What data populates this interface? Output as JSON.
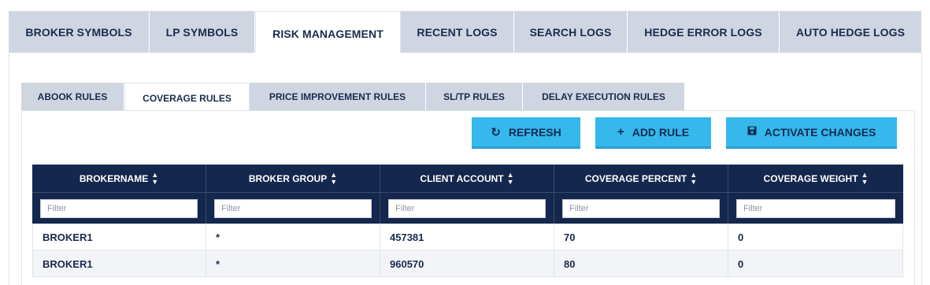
{
  "top_tabs": [
    {
      "label": "BROKER SYMBOLS"
    },
    {
      "label": "LP SYMBOLS"
    },
    {
      "label": "RISK MANAGEMENT",
      "active": true
    },
    {
      "label": "RECENT LOGS"
    },
    {
      "label": "SEARCH LOGS"
    },
    {
      "label": "HEDGE ERROR LOGS"
    },
    {
      "label": "AUTO HEDGE LOGS"
    }
  ],
  "sub_tabs": [
    {
      "label": "ABOOK RULES"
    },
    {
      "label": "COVERAGE RULES",
      "active": true
    },
    {
      "label": "PRICE IMPROVEMENT RULES"
    },
    {
      "label": "SL/TP RULES"
    },
    {
      "label": "DELAY EXECUTION RULES"
    }
  ],
  "toolbar": {
    "refresh_label": "REFRESH",
    "refresh_icon": "refresh-icon",
    "add_rule_label": "ADD RULE",
    "add_rule_icon": "plus-icon",
    "activate_label": "ACTIVATE CHANGES",
    "activate_icon": "save-icon",
    "button_color": "#35b8ec"
  },
  "table": {
    "header_color": "#14274d",
    "columns": [
      "BROKERNAME",
      "BROKER GROUP",
      "CLIENT ACCOUNT",
      "COVERAGE PERCENT",
      "COVERAGE WEIGHT"
    ],
    "sort_icon": "sort-icon",
    "filter_placeholder": "Filter",
    "rows": [
      [
        "BROKER1",
        "*",
        "457381",
        "70",
        "0"
      ],
      [
        "BROKER1",
        "*",
        "960570",
        "80",
        "0"
      ]
    ]
  }
}
